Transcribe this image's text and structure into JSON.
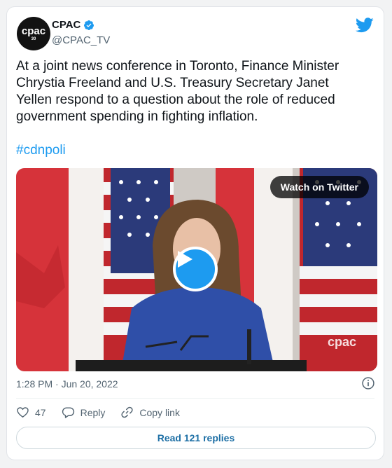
{
  "tweet": {
    "author_name": "CPAC",
    "handle": "@CPAC_TV",
    "avatar_text": "cpac",
    "avatar_sub": "30",
    "text": "At a joint news conference in Toronto, Finance Minister Chrystia Freeland and U.S. Treasury Secretary Janet Yellen respond to a question about the role of reduced government spending in fighting inflation.",
    "hashtag": "#cdnpoli",
    "timestamp": "1:28 PM · Jun 20, 2022"
  },
  "media": {
    "watch_label": "Watch on Twitter",
    "watermark": "cpac"
  },
  "actions": {
    "likes": "47",
    "reply_label": "Reply",
    "copy_label": "Copy link",
    "read_replies": "Read 121 replies"
  },
  "colors": {
    "accent": "#1d9bf0",
    "link": "#1d6fa5",
    "muted": "#536471"
  },
  "icons": [
    "verified-badge-icon",
    "twitter-bird-icon",
    "play-icon",
    "info-icon",
    "heart-icon",
    "reply-icon",
    "link-icon"
  ]
}
